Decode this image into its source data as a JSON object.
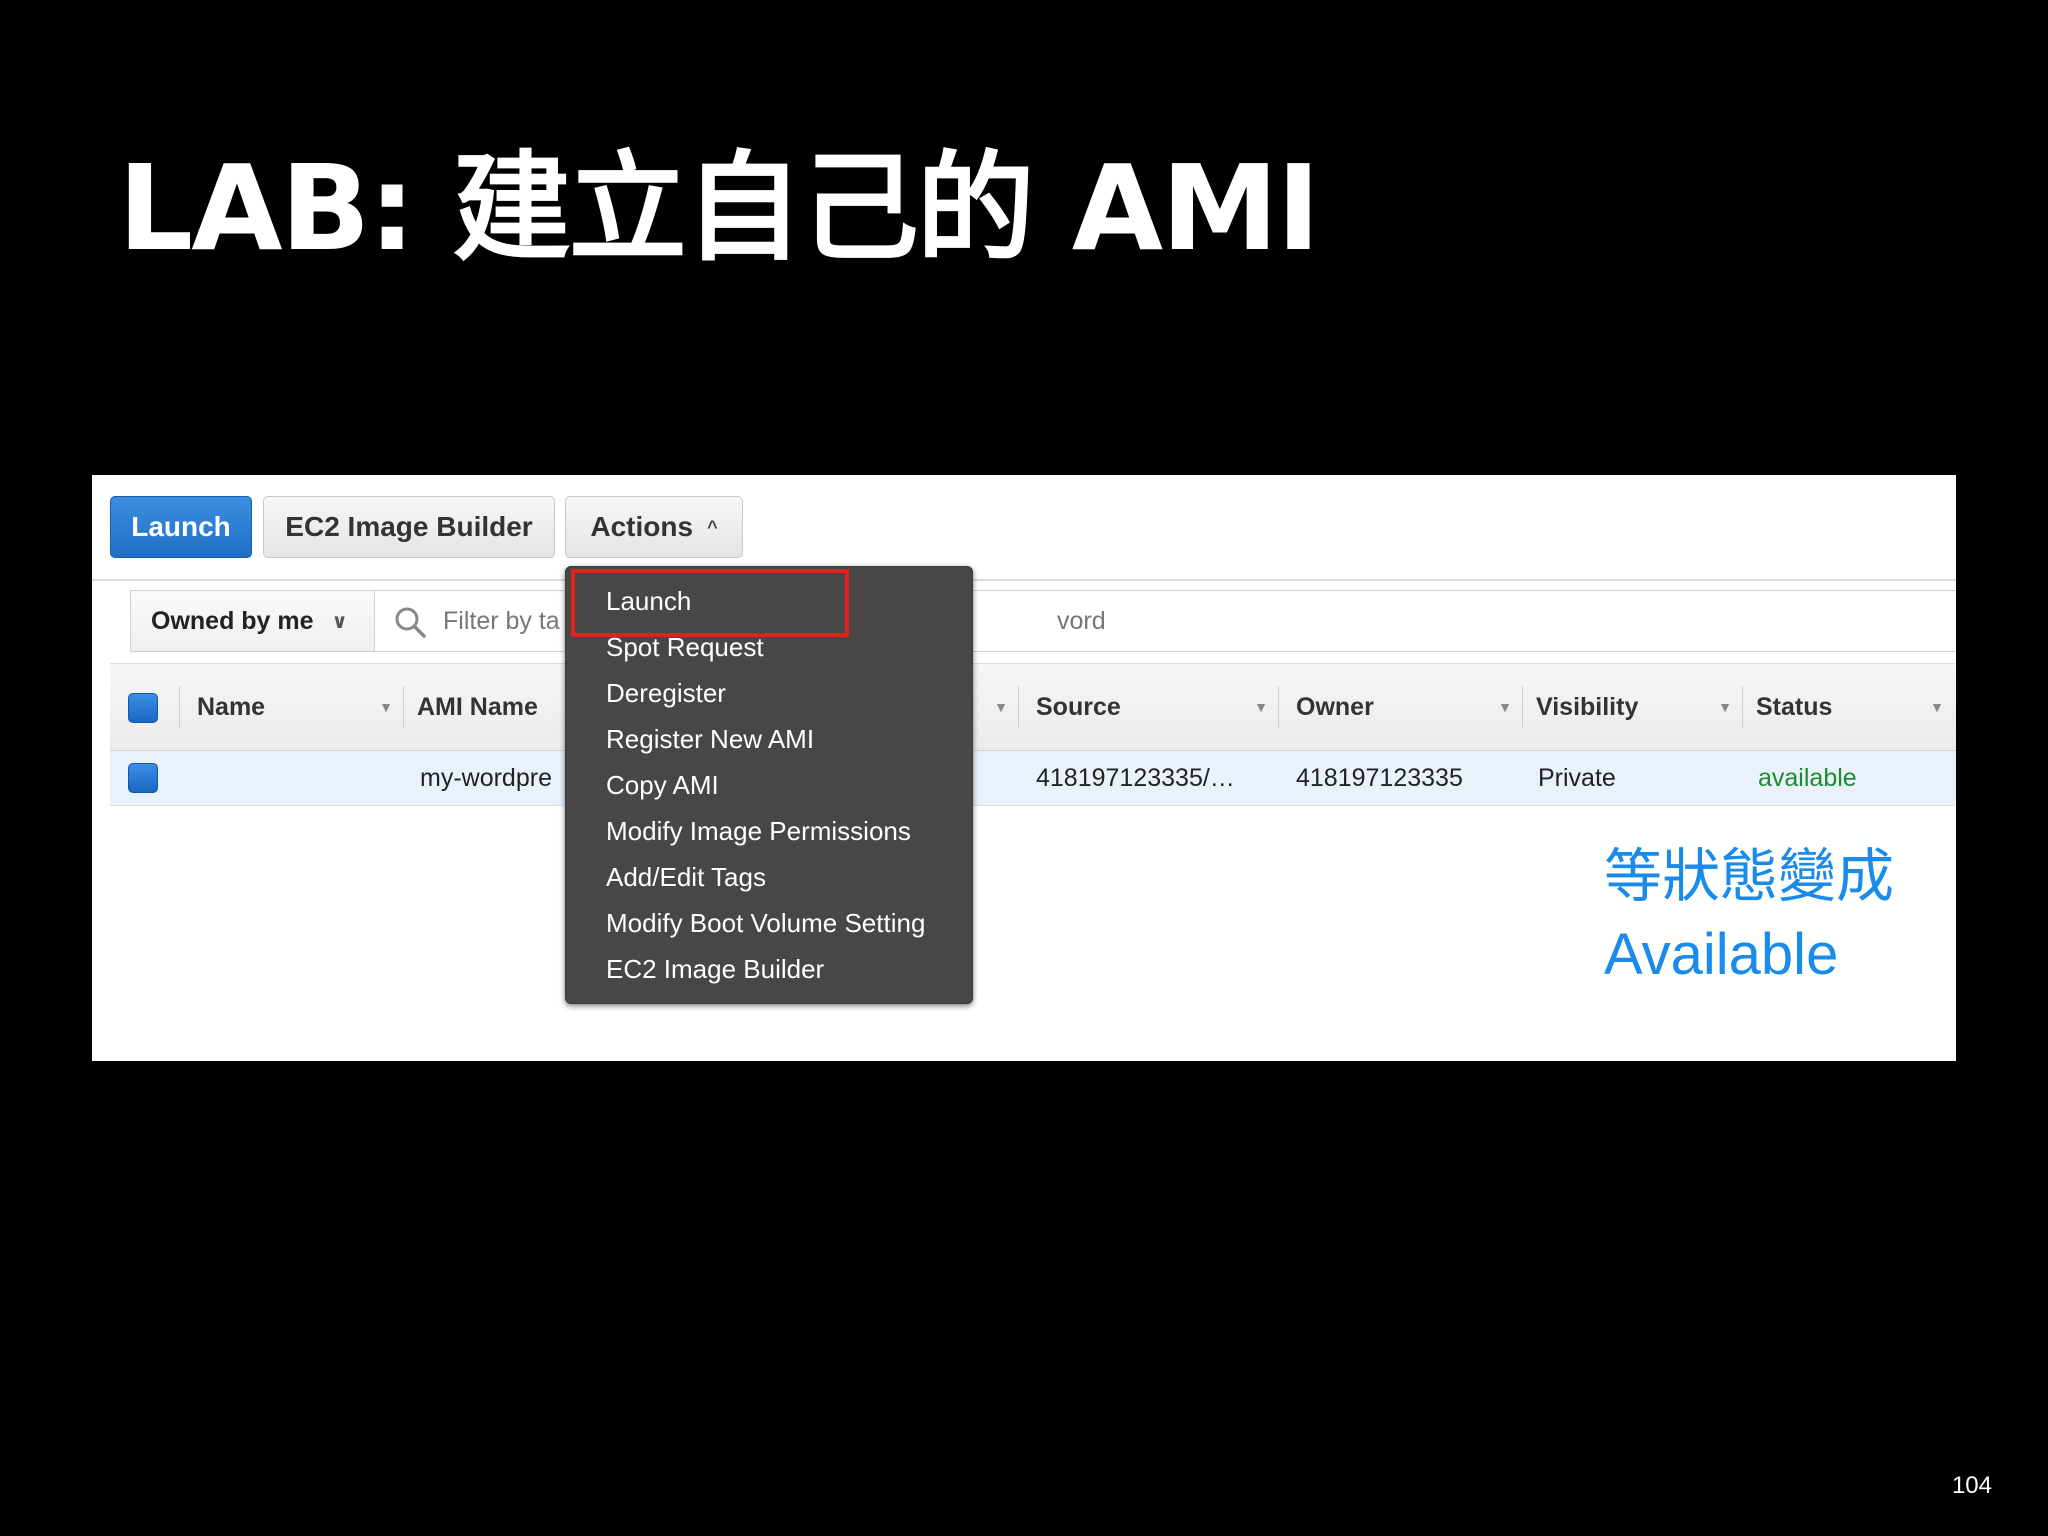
{
  "slide": {
    "title": "LAB: 建立自己的 AMI",
    "page_number": "104"
  },
  "toolbar": {
    "launch_label": "Launch",
    "builder_label": "EC2 Image Builder",
    "actions_label": "Actions",
    "actions_caret": "^"
  },
  "filter": {
    "owned_label": "Owned by me",
    "owned_chevron": "∨",
    "placeholder_visible_start": "Filter by ta",
    "placeholder_visible_end": "vord"
  },
  "table": {
    "columns": {
      "name": "Name",
      "ami_name": "AMI Name",
      "source": "Source",
      "owner": "Owner",
      "visibility": "Visibility",
      "status": "Status"
    },
    "row": {
      "ami_name": "my-wordpre",
      "source": "418197123335/…",
      "owner": "418197123335",
      "visibility": "Private",
      "status": "available"
    }
  },
  "menu": {
    "items": [
      "Launch",
      "Spot Request",
      "Deregister",
      "Register New AMI",
      "Copy AMI",
      "Modify Image Permissions",
      "Add/Edit Tags",
      "Modify Boot Volume Setting",
      "EC2 Image Builder"
    ]
  },
  "note": {
    "line1": "等狀態變成",
    "line2": "Available"
  },
  "colors": {
    "launch_blue": "#1f6fc6",
    "note_blue": "#1a8be8",
    "highlight_red": "#e5201c",
    "available_green": "#1d8c2e",
    "menu_bg": "#474747"
  }
}
